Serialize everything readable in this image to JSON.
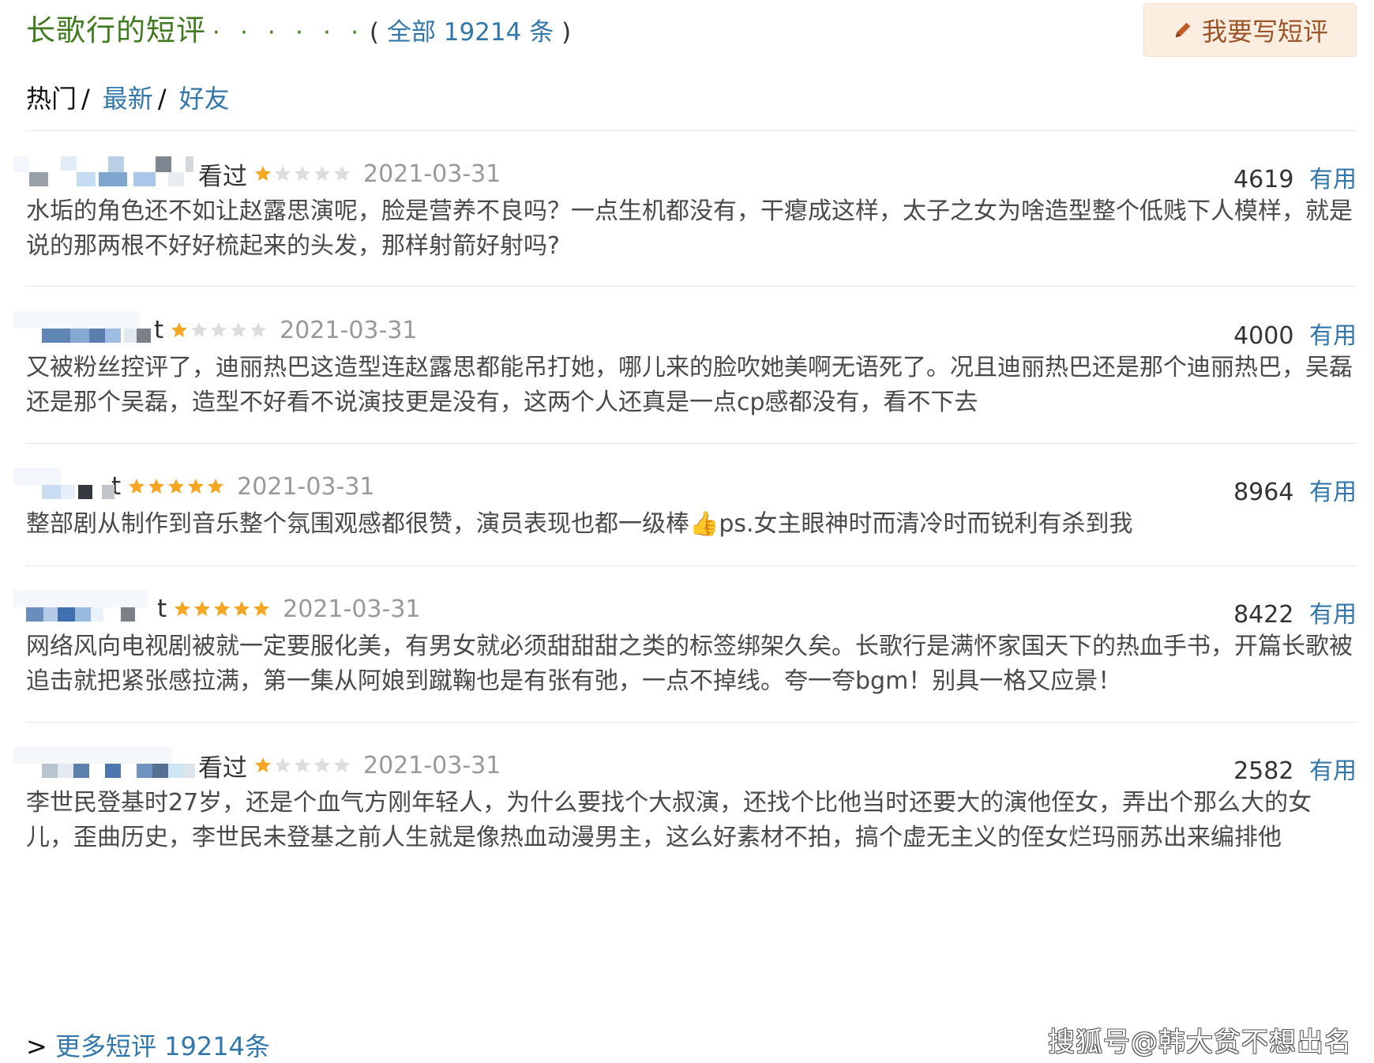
{
  "header": {
    "title": "长歌行的短评",
    "dots": "· · · · · ·",
    "total_open": "(",
    "total_link": "全部 19214 条",
    "total_close": ")",
    "write_button": "我要写短评"
  },
  "tabs": [
    {
      "label": "热门",
      "sep": "/"
    },
    {
      "label": "最新",
      "sep": "/"
    },
    {
      "label": "好友"
    }
  ],
  "reviews": [
    {
      "user_suffix": "看过",
      "rating": 1,
      "date": "2021-03-31",
      "votes": "4619",
      "useful": "有用",
      "text": "水垢的角色还不如让赵露思演呢，脸是营养不良吗？一点生机都没有，干瘪成这样，太子之女为啥造型整个低贱下人模样，就是说的那两根不好好梳起来的头发，那样射箭好射吗?"
    },
    {
      "user_suffix": "t",
      "rating": 1,
      "date": "2021-03-31",
      "votes": "4000",
      "useful": "有用",
      "text": "又被粉丝控评了，迪丽热巴这造型连赵露思都能吊打她，哪儿来的脸吹她美啊无语死了。况且迪丽热巴还是那个迪丽热巴，吴磊还是那个吴磊，造型不好看不说演技更是没有，这两个人还真是一点cp感都没有，看不下去"
    },
    {
      "user_suffix": "t",
      "rating": 5,
      "date": "2021-03-31",
      "votes": "8964",
      "useful": "有用",
      "text": "整部剧从制作到音乐整个氛围观感都很赞，演员表现也都一级棒👍ps.女主眼神时而清冷时而锐利有杀到我"
    },
    {
      "user_suffix": "t",
      "rating": 5,
      "date": "2021-03-31",
      "votes": "8422",
      "useful": "有用",
      "text": "网络风向电视剧被就一定要服化美，有男女就必须甜甜甜之类的标签绑架久矣。长歌行是满怀家国天下的热血手书，开篇长歌被追击就把紧张感拉满，第一集从阿娘到蹴鞠也是有张有弛，一点不掉线。夸一夸bgm！别具一格又应景！"
    },
    {
      "user_suffix": "看过",
      "rating": 1,
      "date": "2021-03-31",
      "votes": "2582",
      "useful": "有用",
      "text": "李世民登基时27岁，还是个血气方刚年轻人，为什么要找个大叔演，还找个比他当时还要大的演他侄女，弄出个那么大的女儿，歪曲历史，李世民未登基之前人生就是像热血动漫男主，这么好素材不拍，搞个虚无主义的侄女烂玛丽苏出来编排他"
    }
  ],
  "more": {
    "arrow": ">",
    "link": "更多短评 19214条"
  },
  "watermark": "搜狐号@韩大贫不想出名",
  "colors": {
    "title_green": "#3f7a1e",
    "link_blue": "#3377aa",
    "star_gold": "#f5a623",
    "star_gray": "#dddddd",
    "button_bg": "#fbeee1",
    "button_text": "#9b5528"
  },
  "icons": {
    "write_button": "pencil-icon",
    "star": "star-icon"
  }
}
